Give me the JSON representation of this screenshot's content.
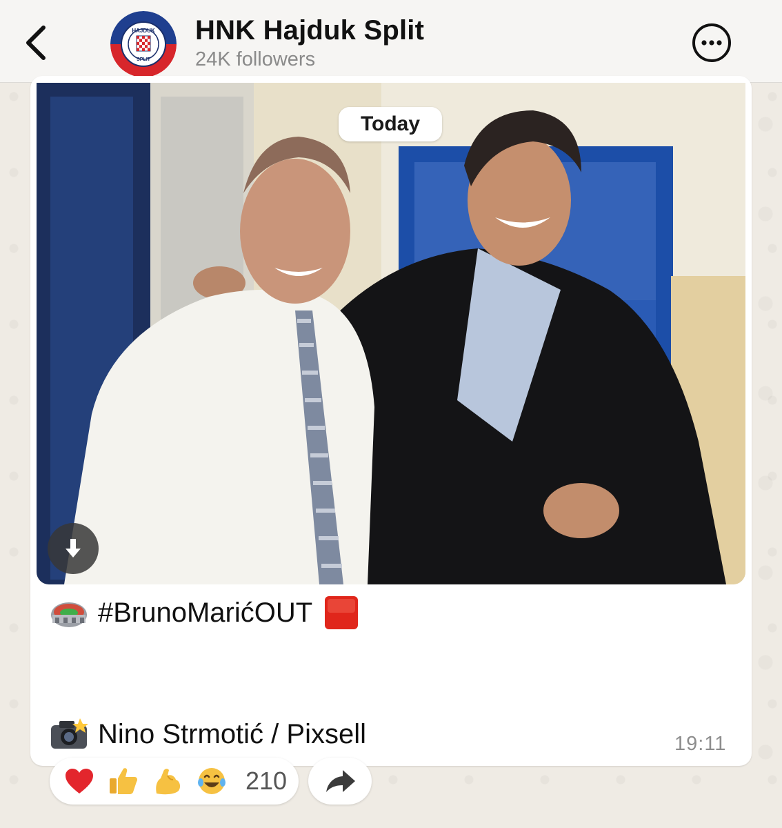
{
  "header": {
    "channel_name": "HNK Hajduk Split",
    "followers": "24K followers",
    "back_icon": "chevron-left-icon",
    "more_icon": "ellipsis-circle-icon",
    "avatar_logo_text_top": "HAJDUK",
    "avatar_logo_text_bottom": "SPLIT"
  },
  "message": {
    "date_separator": "Today",
    "caption_line1": "#BrunoMarićOUT",
    "caption_line1_emoji_left": "stadium-icon",
    "caption_line1_emoji_right": "red-square-icon",
    "caption_line2": "Nino Strmotić / Pixsell",
    "caption_line2_emoji": "camera-flash-icon",
    "time": "19:11",
    "download_icon": "download-arrow-icon"
  },
  "reactions": {
    "items": [
      "heart",
      "thumbs-up",
      "flexed-biceps",
      "tears-of-joy"
    ],
    "count": "210",
    "forward_icon": "forward-arrow-icon"
  },
  "colors": {
    "header_bg": "#f6f5f3",
    "wallpaper": "#efebe4",
    "bubble": "#ffffff",
    "club_red": "#d7262b",
    "club_blue": "#1f3f8f",
    "red_square": "#e0261b"
  }
}
